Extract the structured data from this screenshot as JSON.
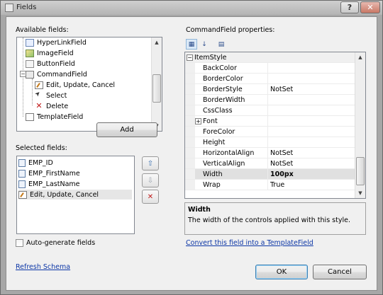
{
  "window": {
    "title": "Fields",
    "help_label": "?",
    "close_label": "✕"
  },
  "available": {
    "label": "Available fields:",
    "items": [
      {
        "label": "HyperLinkField",
        "icon": "hyperlink-field-icon"
      },
      {
        "label": "ImageField",
        "icon": "image-field-icon"
      },
      {
        "label": "ButtonField",
        "icon": "button-field-icon"
      },
      {
        "label": "CommandField",
        "icon": "command-field-icon",
        "expander": "−"
      },
      {
        "label": "Edit, Update, Cancel",
        "icon": "edit-pencil-icon"
      },
      {
        "label": "Select",
        "icon": "select-cursor-icon"
      },
      {
        "label": "Delete",
        "icon": "delete-x-icon"
      },
      {
        "label": "TemplateField",
        "icon": "template-field-icon"
      }
    ],
    "add_label": "Add"
  },
  "selected": {
    "label": "Selected fields:",
    "items": [
      {
        "label": "EMP_ID",
        "icon": "bound-field-icon"
      },
      {
        "label": "EMP_FirstName",
        "icon": "bound-field-icon"
      },
      {
        "label": "EMP_LastName",
        "icon": "bound-field-icon"
      },
      {
        "label": "Edit, Update, Cancel",
        "icon": "edit-pencil-icon"
      }
    ],
    "move_up": "⇧",
    "move_down": "⇩",
    "remove": "✕"
  },
  "autogenerate": {
    "label": "Auto-generate fields",
    "checked": false
  },
  "refresh_label": "Refresh Schema",
  "properties": {
    "label": "CommandField properties:",
    "category": "ItemStyle",
    "category_expander": "−",
    "rows": [
      {
        "name": "BackColor",
        "value": ""
      },
      {
        "name": "BorderColor",
        "value": ""
      },
      {
        "name": "BorderStyle",
        "value": "NotSet"
      },
      {
        "name": "BorderWidth",
        "value": ""
      },
      {
        "name": "CssClass",
        "value": ""
      },
      {
        "name": "Font",
        "value": "",
        "expander": "+"
      },
      {
        "name": "ForeColor",
        "value": ""
      },
      {
        "name": "Height",
        "value": ""
      },
      {
        "name": "HorizontalAlign",
        "value": "NotSet"
      },
      {
        "name": "VerticalAlign",
        "value": "NotSet"
      },
      {
        "name": "Width",
        "value": "100px",
        "selected": true
      },
      {
        "name": "Wrap",
        "value": "True"
      }
    ]
  },
  "help": {
    "title": "Width",
    "description": "The width of the controls applied with this style."
  },
  "convert_link": "Convert this field into a TemplateField",
  "ok_label": "OK",
  "cancel_label": "Cancel"
}
